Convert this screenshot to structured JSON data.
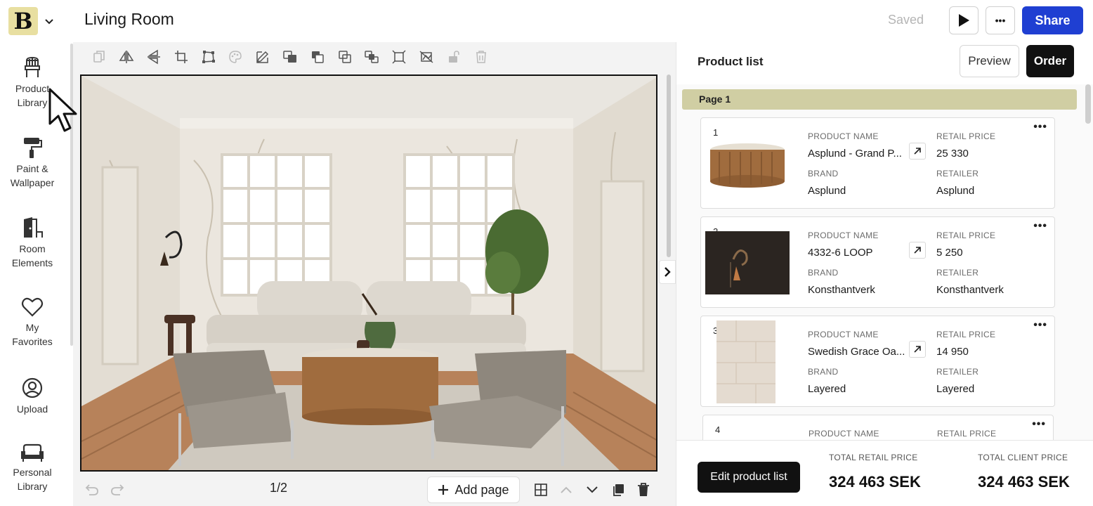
{
  "header": {
    "logo_letter": "B",
    "title": "Living Room",
    "saved_label": "Saved",
    "share_label": "Share",
    "more_label": "•••"
  },
  "sidebar": {
    "items": [
      {
        "label_1": "Product",
        "label_2": "Library",
        "icon": "chair-icon"
      },
      {
        "label_1": "Paint &",
        "label_2": "Wallpaper",
        "icon": "paint-roller-icon"
      },
      {
        "label_1": "Room",
        "label_2": "Elements",
        "icon": "door-icon"
      },
      {
        "label_1": "My",
        "label_2": "Favorites",
        "icon": "heart-icon"
      },
      {
        "label_1": "Upload",
        "label_2": "",
        "icon": "user-circle-icon"
      },
      {
        "label_1": "Personal",
        "label_2": "Library",
        "icon": "sofa-icon"
      }
    ]
  },
  "canvas": {
    "page_indicator": "1/2",
    "add_page_label": "Add page"
  },
  "product_list": {
    "title": "Product list",
    "preview_label": "Preview",
    "order_label": "Order",
    "page_label": "Page 1",
    "field_labels": {
      "product_name": "PRODUCT NAME",
      "retail_price": "RETAIL PRICE",
      "brand": "BRAND",
      "retailer": "RETAILER"
    },
    "items": [
      {
        "num": "1",
        "name": "Asplund - Grand P...",
        "price": "25 330",
        "brand": "Asplund",
        "retailer": "Asplund"
      },
      {
        "num": "2",
        "name": "4332-6 LOOP",
        "price": "5 250",
        "brand": "Konsthantverk",
        "retailer": "Konsthantverk"
      },
      {
        "num": "3",
        "name": "Swedish Grace Oa...",
        "price": "14 950",
        "brand": "Layered",
        "retailer": "Layered"
      },
      {
        "num": "4",
        "name": "",
        "price": "",
        "brand": "",
        "retailer": ""
      }
    ],
    "footer": {
      "edit_label": "Edit product list",
      "total_retail_label": "TOTAL RETAIL PRICE",
      "total_retail_value": "324 463 SEK",
      "total_client_label": "TOTAL CLIENT PRICE",
      "total_client_value": "324 463 SEK"
    }
  },
  "colors": {
    "accent_blue": "#1f3fd2",
    "logo_bg": "#e8dfa1",
    "page_bar": "#d0cea3"
  }
}
